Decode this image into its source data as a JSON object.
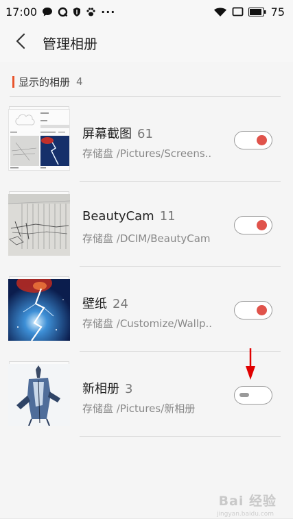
{
  "status_bar": {
    "time": "17:00",
    "dots": "···",
    "battery": "75",
    "icons": [
      "chat-bubble-icon",
      "q-app-icon",
      "shield-icon",
      "paw-icon",
      "wifi-icon",
      "screen-cast-icon",
      "battery-icon"
    ]
  },
  "header": {
    "title": "管理相册",
    "back_icon": "chevron-left-icon"
  },
  "section": {
    "label": "显示的相册",
    "count": "4",
    "accent": "#e8542c"
  },
  "albums": [
    {
      "name": "屏幕截图",
      "count": "61",
      "path": "存储盘 /Pictures/Screens..",
      "enabled": true
    },
    {
      "name": "BeautyCam",
      "count": "11",
      "path": "存储盘 /DCIM/BeautyCam",
      "enabled": true
    },
    {
      "name": "壁纸",
      "count": "24",
      "path": "存储盘 /Customize/Wallp..",
      "enabled": true
    },
    {
      "name": "新相册",
      "count": "3",
      "path": "存储盘 /Pictures/新相册",
      "enabled": false
    }
  ],
  "toggle_colors": {
    "on_knob": "#e0534b",
    "off_knob": "#9a9a9a"
  },
  "watermark": {
    "text": "Bai 经验",
    "sub": "jingyan.baidu.com"
  }
}
